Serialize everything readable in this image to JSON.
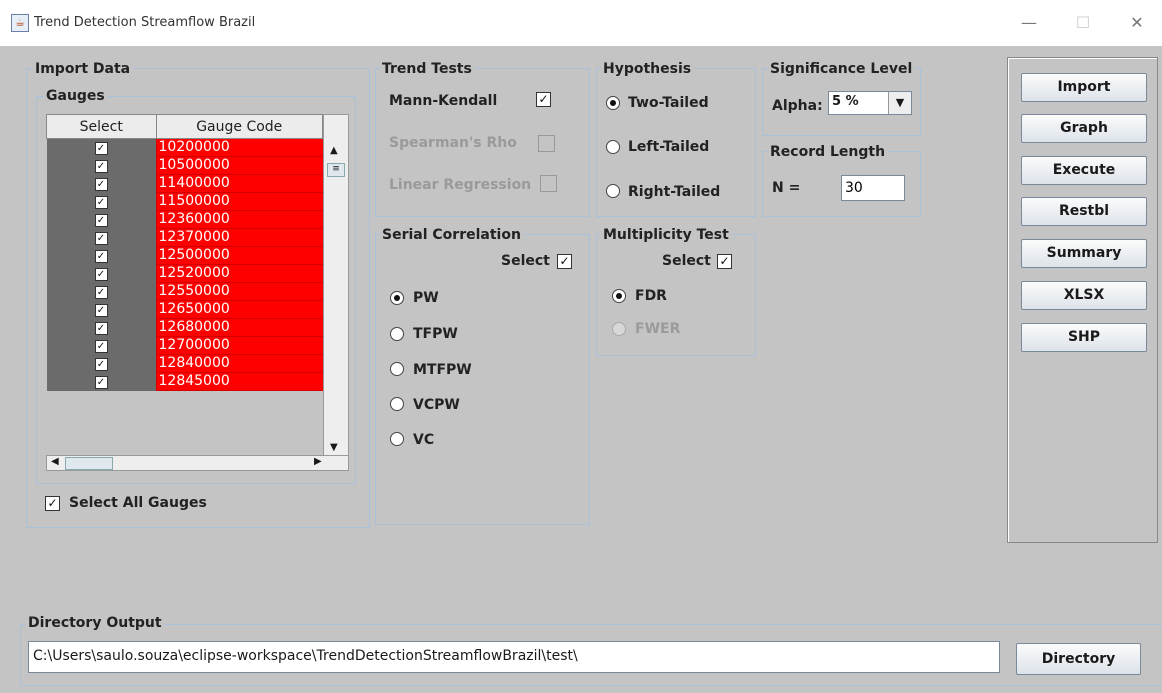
{
  "window": {
    "title": "Trend Detection Streamflow Brazil",
    "minimize": "—",
    "maximize": "☐",
    "close": "✕"
  },
  "import_data": {
    "title": "Import Data",
    "gauges_title": "Gauges",
    "columns": [
      "Select",
      "Gauge Code"
    ],
    "rows": [
      {
        "selected": "✓",
        "code": "10200000"
      },
      {
        "selected": "✓",
        "code": "10500000"
      },
      {
        "selected": "✓",
        "code": "11400000"
      },
      {
        "selected": "✓",
        "code": "11500000"
      },
      {
        "selected": "✓",
        "code": "12360000"
      },
      {
        "selected": "✓",
        "code": "12370000"
      },
      {
        "selected": "✓",
        "code": "12500000"
      },
      {
        "selected": "✓",
        "code": "12520000"
      },
      {
        "selected": "✓",
        "code": "12550000"
      },
      {
        "selected": "✓",
        "code": "12650000"
      },
      {
        "selected": "✓",
        "code": "12680000"
      },
      {
        "selected": "✓",
        "code": "12700000"
      },
      {
        "selected": "✓",
        "code": "12840000"
      },
      {
        "selected": "✓",
        "code": "12845000"
      }
    ],
    "select_all_label": "Select All Gauges",
    "select_all_check": "✓"
  },
  "trend_tests": {
    "title": "Trend Tests",
    "mann_kendall": "Mann-Kendall",
    "mann_kendall_check": "✓",
    "spearman": "Spearman's Rho",
    "linear": "Linear Regression"
  },
  "hypothesis": {
    "title": "Hypothesis",
    "options": [
      "Two-Tailed",
      "Left-Tailed",
      "Right-Tailed"
    ]
  },
  "significance": {
    "title": "Significance Level",
    "alpha_label": "Alpha:",
    "alpha_value": "5 %"
  },
  "record_length": {
    "title": "Record Length",
    "n_label": "N =",
    "n_value": "30"
  },
  "serial_correlation": {
    "title": "Serial Correlation",
    "select_label": "Select",
    "select_check": "✓",
    "options": [
      "PW",
      "TFPW",
      "MTFPW",
      "VCPW",
      "VC"
    ]
  },
  "multiplicity": {
    "title": "Multiplicity Test",
    "select_label": "Select",
    "select_check": "✓",
    "options": [
      "FDR",
      "FWER"
    ]
  },
  "actions": [
    "Import",
    "Graph",
    "Execute",
    "Restbl",
    "Summary",
    "XLSX",
    "SHP"
  ],
  "directory": {
    "title": "Directory Output",
    "path": "C:\\Users\\saulo.souza\\eclipse-workspace\\TrendDetectionStreamflowBrazil\\test\\",
    "button": "Directory"
  }
}
